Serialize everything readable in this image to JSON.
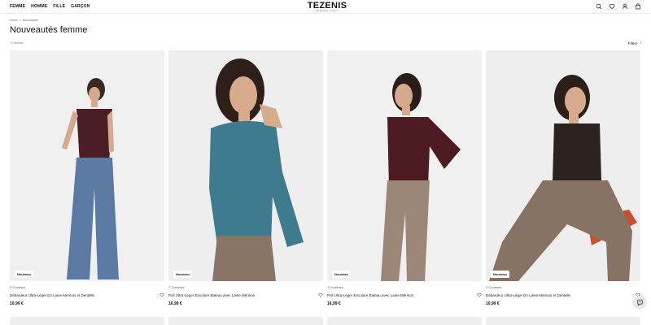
{
  "nav": [
    "FEMME",
    "HOMME",
    "FILLE",
    "GARÇON"
  ],
  "logo": {
    "main": "TEZENIS",
    "sub": "VERONA·ITALY"
  },
  "header_icons": [
    "search-icon",
    "heart-icon",
    "user-icon",
    "bag-icon"
  ],
  "breadcrumb": {
    "home": "Home",
    "sep": ">",
    "current": "Nouveautés"
  },
  "page": {
    "title": "Nouveautés femme",
    "count": "71 articles",
    "filter_label": "Filtrer",
    "filter_arrow": "›"
  },
  "products": [
    {
      "badge": "Nouveau",
      "colors": "3 Couleurs",
      "name": "Débardeur Ultra-Léger En Laine Mérinos et Dentelle",
      "price": "10,99 €",
      "top_color": "#4a1e24",
      "bottom_color": "#5b7aa3"
    },
    {
      "badge": "Nouveau",
      "colors": "7 Couleurs",
      "name": "Pull Ultra-Léger Encolure Bateau avec Laine Mérinos",
      "price": "16,99 €",
      "top_color": "#3e7b8e",
      "bottom_color": "#8a7466"
    },
    {
      "badge": "Nouveau",
      "colors": "7 Couleurs",
      "name": "Pull Ultra-Léger Encolure Bateau avec Laine Mérinos",
      "price": "16,99 €",
      "top_color": "#4e1a22",
      "bottom_color": "#9c8677"
    },
    {
      "badge": "Nouveau",
      "colors": "3 Couleurs",
      "name": "Débardeur Ultra-Léger En Laine Mérinos et Dentelle",
      "price": "10,99 €",
      "top_color": "#2c2320",
      "bottom_color": "#877264"
    }
  ],
  "chat_icon": "chat-icon"
}
